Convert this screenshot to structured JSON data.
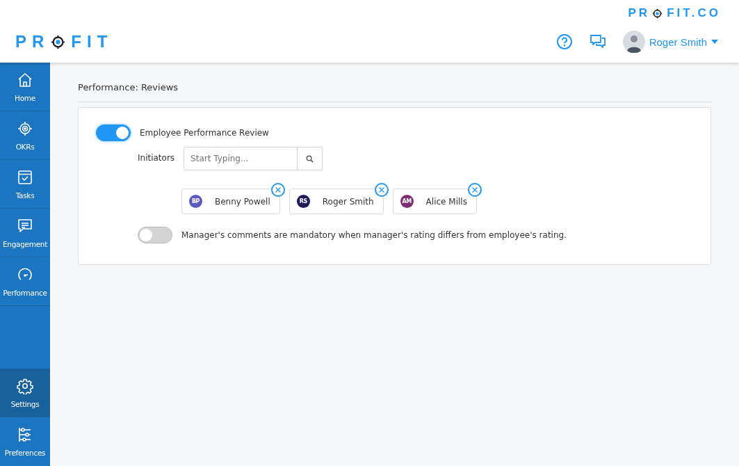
{
  "brand": {
    "top_logo": {
      "before": "PR",
      "after": "FIT.CO"
    },
    "main_logo": {
      "before": "PR",
      "after": "FIT"
    }
  },
  "header": {
    "user_name": "Roger Smith"
  },
  "sidebar": {
    "items": [
      {
        "label": "Home",
        "kind": "home",
        "selected": false
      },
      {
        "label": "OKRs",
        "kind": "target",
        "selected": false
      },
      {
        "label": "Tasks",
        "kind": "calendar",
        "selected": false
      },
      {
        "label": "Engagement",
        "kind": "chat",
        "selected": false
      },
      {
        "label": "Performance",
        "kind": "gauge",
        "selected": false
      }
    ],
    "bottom_items": [
      {
        "label": "Settings",
        "kind": "gear",
        "selected": true
      },
      {
        "label": "Preferences",
        "kind": "sliders",
        "selected": false
      }
    ]
  },
  "page": {
    "title": "Performance: Reviews",
    "review_toggle": {
      "label": "Employee Performance Review",
      "on": true
    },
    "initiators": {
      "label": "Initiators",
      "placeholder": "Start Typing...",
      "people": [
        {
          "initials": "BP",
          "name": "Benny Powell",
          "color": "#5b5bbf"
        },
        {
          "initials": "RS",
          "name": "Roger Smith",
          "color": "#1e1a5c"
        },
        {
          "initials": "AM",
          "name": "Alice Mills",
          "color": "#7e2f73"
        }
      ]
    },
    "comments_toggle": {
      "label": "Manager's comments are mandatory when manager's rating differs from employee's rating.",
      "on": false
    }
  }
}
